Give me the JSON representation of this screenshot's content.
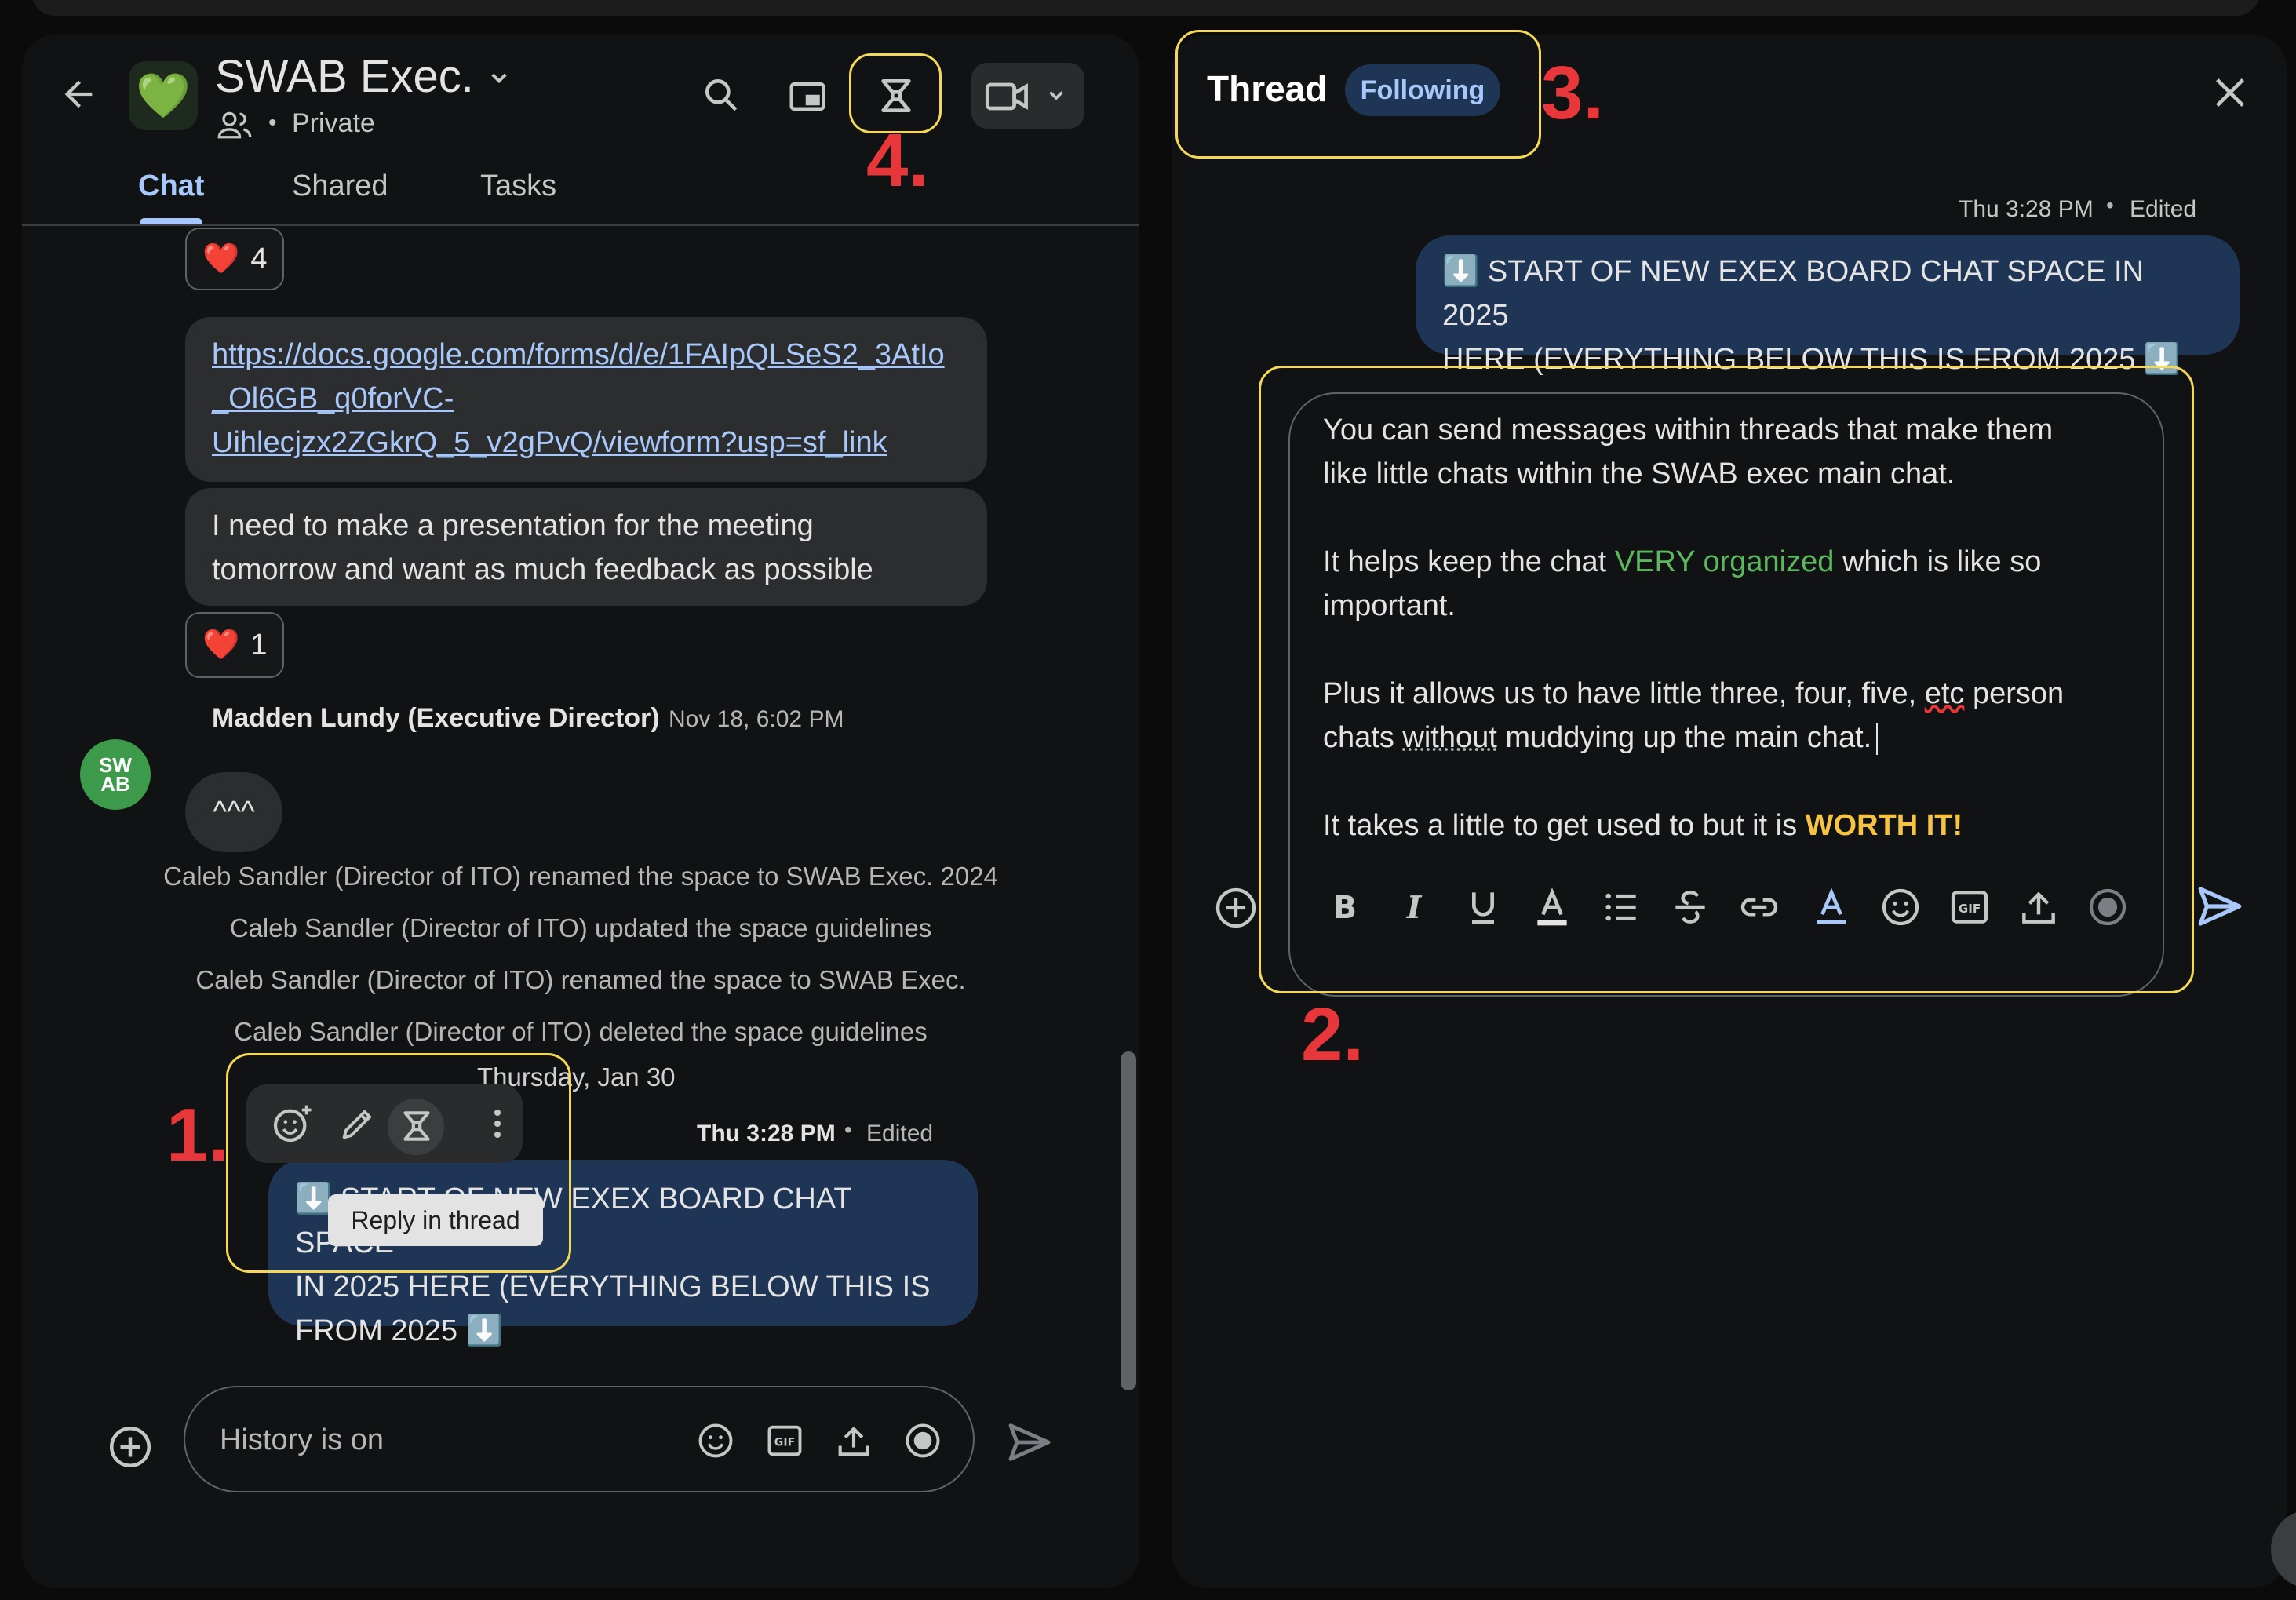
{
  "space": {
    "emoji": "💚",
    "name": "SWAB Exec.",
    "privacy": "Private",
    "tabs": [
      "Chat",
      "Shared",
      "Tasks"
    ]
  },
  "messages": {
    "reaction1": {
      "emoji": "❤️",
      "count": "4"
    },
    "link_lines": [
      "https://docs.google.com/forms/d/e/1FAIpQLSeS2_3AtIo",
      "_Ol6GB_q0forVC-",
      "Uihlecjzx2ZGkrQ_5_v2gPvQ/viewform?usp=sf_link"
    ],
    "presentation_lines": [
      "I need to make a presentation for the meeting",
      "tomorrow and want as much feedback as possible"
    ],
    "reaction2": {
      "emoji": "❤️",
      "count": "1"
    },
    "madden": {
      "name": "Madden Lundy (Executive Director)",
      "time": "Nov 18, 6:02 PM",
      "text": "^^^",
      "avatar_text": "SW AB"
    },
    "system_lines": [
      "Caleb Sandler (Director of ITO) renamed the space to SWAB Exec. 2024",
      "Caleb Sandler (Director of ITO) updated the space guidelines",
      "Caleb Sandler (Director of ITO) renamed the space to SWAB Exec.",
      "Caleb Sandler (Director of ITO) deleted the space guidelines"
    ],
    "date_divider": "Thursday, Jan 30",
    "own": {
      "time": "Thu 3:28 PM",
      "edited": "Edited",
      "lines": [
        "⬇️ START OF NEW EXEX BOARD CHAT SPACE",
        "IN 2025 HERE (EVERYTHING BELOW THIS IS",
        "FROM 2025 ⬇️"
      ]
    },
    "tooltip": "Reply in thread"
  },
  "composer": {
    "placeholder": "History is on"
  },
  "thread": {
    "title": "Thread",
    "following": "Following",
    "time": "Thu 3:28 PM",
    "edited": "Edited",
    "message_lines": [
      "⬇️ START OF NEW EXEX BOARD CHAT SPACE IN 2025",
      "HERE (EVERYTHING BELOW THIS IS FROM 2025 ⬇️"
    ],
    "draft": {
      "p1": [
        "You can send messages within threads that make them",
        "like little chats within the SWAB exec main chat."
      ],
      "p2_a": "It helps keep the chat ",
      "p2_highlight": "VERY organized",
      "p2_b": " which is like so",
      "p2_line2": "important.",
      "p3_line1_a": "Plus it allows us to have little three, four, five, ",
      "p3_line1_etc": "etc",
      "p3_line1_b": " person",
      "p3_line2_a": "chats ",
      "p3_line2_without": "without",
      "p3_line2_b": " muddying up the main chat.",
      "p4_a": "It takes a little to get used to but it is ",
      "p4_bold": "WORTH IT!"
    }
  },
  "annotations": [
    "1.",
    "2.",
    "3.",
    "4."
  ],
  "colors": {
    "panel": "#111213",
    "own_bubble": "#1f3556",
    "other_bubble": "#2c2d2f",
    "accent": "#a8c7fa",
    "annotation_red": "#e8373b",
    "annotation_box": "#f6d859",
    "highlight_green": "#4caf50",
    "worth_yellow": "#f6c342"
  }
}
